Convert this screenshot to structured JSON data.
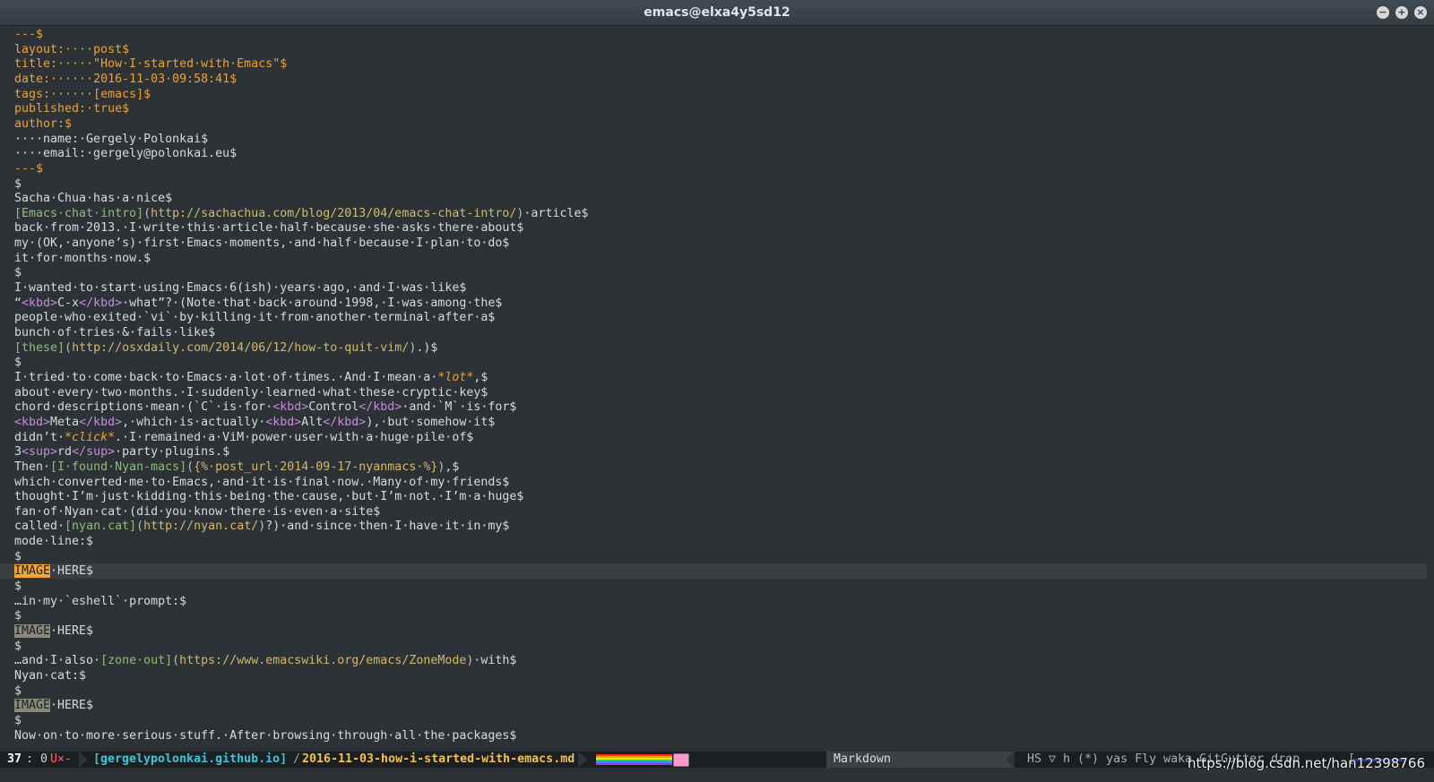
{
  "window": {
    "title": "emacs@elxa4y5sd12",
    "controls": {
      "minimize": "−",
      "maximize": "+",
      "close": "×"
    }
  },
  "buffer": {
    "lines": [
      {
        "t": "---$",
        "k": "fm"
      },
      {
        "t": "layout:····post$",
        "k": "fm"
      },
      {
        "t": "title:·····\"How·I·started·with·Emacs\"$",
        "k": "fm"
      },
      {
        "t": "date:······2016-11-03·09:58:41$",
        "k": "fm"
      },
      {
        "t": "tags:······[emacs]$",
        "k": "fm"
      },
      {
        "t": "published:·true$",
        "k": "fm"
      },
      {
        "t": "author:$",
        "k": "fm"
      },
      {
        "t": "····name:·Gergely·Polonkai$",
        "k": "fmsub"
      },
      {
        "t": "····email:·gergely@polonkai.eu$",
        "k": "fmsub"
      },
      {
        "t": "---$",
        "k": "fm"
      },
      {
        "t": "$",
        "k": "txt"
      },
      {
        "t": "Sacha·Chua·has·a·nice$",
        "k": "txt"
      },
      {
        "t": "[Emacs·chat·intro](http://sachachua.com/blog/2013/04/emacs-chat-intro/)·article$",
        "k": "txt"
      },
      {
        "t": "back·from·2013.·I·write·this·article·half·because·she·asks·there·about$",
        "k": "txt"
      },
      {
        "t": "my·(OK,·anyone’s)·first·Emacs·moments,·and·half·because·I·plan·to·do$",
        "k": "txt"
      },
      {
        "t": "it·for·months·now.$",
        "k": "txt"
      },
      {
        "t": "$",
        "k": "txt"
      },
      {
        "t": "I·wanted·to·start·using·Emacs·6(ish)·years·ago,·and·I·was·like$",
        "k": "txt"
      },
      {
        "t": "“<kbd>C-x</kbd>·what”?·(Note·that·back·around·1998,·I·was·among·the$",
        "k": "txt"
      },
      {
        "t": "people·who·exited·`vi`·by·killing·it·from·another·terminal·after·a$",
        "k": "txt"
      },
      {
        "t": "bunch·of·tries·&·fails·like$",
        "k": "txt"
      },
      {
        "t": "[these](http://osxdaily.com/2014/06/12/how-to-quit-vim/).)$",
        "k": "txt"
      },
      {
        "t": "$",
        "k": "txt"
      },
      {
        "t": "I·tried·to·come·back·to·Emacs·a·lot·of·times.·And·I·mean·a·*lot*,$",
        "k": "txt"
      },
      {
        "t": "about·every·two·months.·I·suddenly·learned·what·these·cryptic·key$",
        "k": "txt"
      },
      {
        "t": "chord·descriptions·mean·(`C`·is·for·<kbd>Control</kbd>·and·`M`·is·for$",
        "k": "txt"
      },
      {
        "t": "<kbd>Meta</kbd>,·which·is·actually·<kbd>Alt</kbd>),·but·somehow·it$",
        "k": "txt"
      },
      {
        "t": "didn’t·*click*.·I·remained·a·ViM·power·user·with·a·huge·pile·of$",
        "k": "txt"
      },
      {
        "t": "3<sup>rd</sup>·party·plugins.$",
        "k": "txt"
      },
      {
        "t": "Then·[I·found·Nyan-macs]({%·post_url·2014-09-17-nyanmacs·%}),$",
        "k": "txt"
      },
      {
        "t": "which·converted·me·to·Emacs,·and·it·is·final·now.·Many·of·my·friends$",
        "k": "txt"
      },
      {
        "t": "thought·I’m·just·kidding·this·being·the·cause,·but·I’m·not.·I’m·a·huge$",
        "k": "txt"
      },
      {
        "t": "fan·of·Nyan·cat·(did·you·know·there·is·even·a·site$",
        "k": "txt"
      },
      {
        "t": "called·[nyan.cat](http://nyan.cat/)?)·and·since·then·I·have·it·in·my$",
        "k": "txt"
      },
      {
        "t": "mode·line:$",
        "k": "txt"
      },
      {
        "t": "$",
        "k": "txt"
      },
      {
        "t": "IMAGE·HERE$",
        "k": "img",
        "current": true
      },
      {
        "t": "$",
        "k": "txt"
      },
      {
        "t": "…in·my·`eshell`·prompt:$",
        "k": "txt"
      },
      {
        "t": "$",
        "k": "txt"
      },
      {
        "t": "IMAGE·HERE$",
        "k": "img"
      },
      {
        "t": "$",
        "k": "txt"
      },
      {
        "t": "…and·I·also·[zone·out](https://www.emacswiki.org/emacs/ZoneMode)·with$",
        "k": "txt"
      },
      {
        "t": "Nyan·cat:$",
        "k": "txt"
      },
      {
        "t": "$",
        "k": "txt"
      },
      {
        "t": "IMAGE·HERE$",
        "k": "img"
      },
      {
        "t": "$",
        "k": "txt"
      },
      {
        "t": "Now·on·to·more·serious·stuff.·After·browsing·through·all·the·packages$",
        "k": "txt"
      }
    ]
  },
  "modeline": {
    "line_number": "37",
    "column": ": 0",
    "modified": "U×-",
    "project": "[gergelypolonkai.github.io]",
    "separator": "/",
    "filename": "2016-11-03-how-i-started-with-emacs.md",
    "major_mode": "Markdown",
    "minor_modes": "HS ▽ h (*) yas Fly waka GitGutter drop",
    "right_end": "["
  },
  "watermark": "https://blog.csdn.net/han12398766"
}
